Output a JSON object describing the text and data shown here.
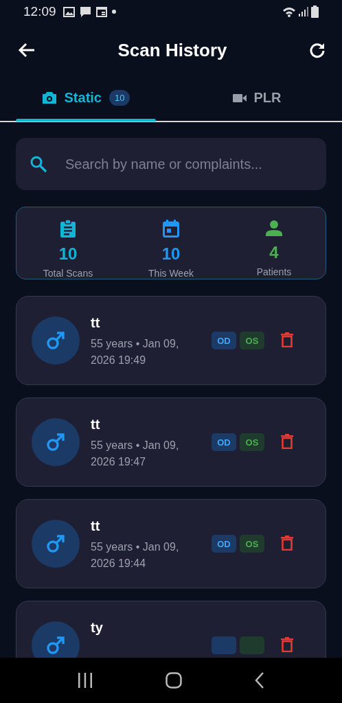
{
  "status_bar": {
    "time": "12:09"
  },
  "header": {
    "title": "Scan History"
  },
  "tabs": [
    {
      "label": "Static",
      "badge": "10",
      "selected": true
    },
    {
      "label": "PLR",
      "selected": false
    }
  ],
  "search": {
    "placeholder": "Search by name or complaints..."
  },
  "stats": [
    {
      "value": "10",
      "label": "Total Scans",
      "color": "#12b5d6"
    },
    {
      "value": "10",
      "label": "This Week",
      "color": "#2196f3"
    },
    {
      "value": "4",
      "label": "Patients",
      "color": "#4caf50"
    }
  ],
  "scans": [
    {
      "name": "tt",
      "details": "55 years • Jan 09, 2026 19:49",
      "badges": [
        {
          "kind": "od",
          "label": "OD"
        },
        {
          "kind": "os",
          "label": "OS"
        }
      ]
    },
    {
      "name": "tt",
      "details": "55 years • Jan 09, 2026 19:47",
      "badges": [
        {
          "kind": "od",
          "label": "OD"
        },
        {
          "kind": "os",
          "label": "OS"
        }
      ]
    },
    {
      "name": "tt",
      "details": "55 years • Jan 09, 2026 19:44",
      "badges": [
        {
          "kind": "od",
          "label": "OD"
        },
        {
          "kind": "os",
          "label": "OS"
        }
      ]
    },
    {
      "name": "ty",
      "badges": [
        {
          "kind": "od"
        },
        {
          "kind": "os"
        }
      ]
    }
  ]
}
